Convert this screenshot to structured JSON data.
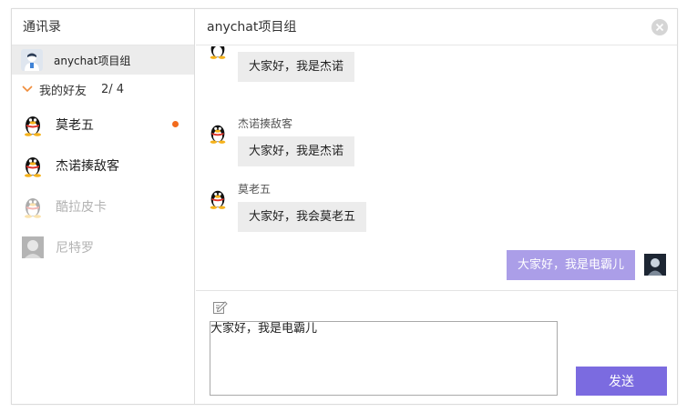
{
  "sidebar": {
    "title": "通讯录",
    "group": {
      "name": "anychat项目组"
    },
    "friends_header": {
      "label": "我的好友",
      "count": "2/ 4"
    },
    "friends": [
      {
        "name": "莫老五",
        "online": true,
        "unread": true
      },
      {
        "name": "杰诺揍敌客",
        "online": true,
        "unread": false
      },
      {
        "name": "酷拉皮卡",
        "online": false,
        "unread": false
      },
      {
        "name": "尼特罗",
        "online": false,
        "unread": false
      }
    ]
  },
  "chat": {
    "title": "anychat项目组",
    "messages": [
      {
        "sender": "",
        "text": "大家好，我是杰诺"
      },
      {
        "sender": "杰诺揍敌客",
        "text": "大家好，我是杰诺"
      },
      {
        "sender": "莫老五",
        "text": "大家好，我会莫老五"
      },
      {
        "sender": "self",
        "text": "大家好，我是电霸儿"
      }
    ],
    "composer": {
      "value": "大家好，我是电霸儿",
      "send_label": "发送"
    }
  },
  "colors": {
    "accent": "#7b6be0",
    "self_bubble": "#ab9ee8",
    "other_bubble": "#ececec",
    "unread_dot": "#f26b1d",
    "chevron": "#f08c3a"
  }
}
